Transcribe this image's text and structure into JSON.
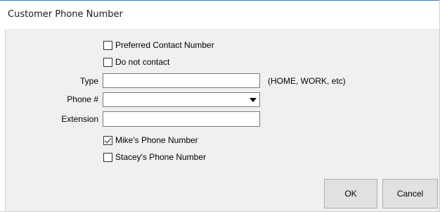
{
  "dialog": {
    "title": "Customer Phone Number"
  },
  "form": {
    "preferred_contact": {
      "label": "Preferred Contact Number",
      "checked": false
    },
    "do_not_contact": {
      "label": "Do not contact",
      "checked": false
    },
    "type": {
      "label": "Type",
      "value": "",
      "hint": "(HOME, WORK, etc)"
    },
    "phone": {
      "label": "Phone #",
      "value": ""
    },
    "extension": {
      "label": "Extension",
      "value": ""
    },
    "mikes_phone": {
      "label": "Mike's Phone Number",
      "checked": true
    },
    "staceys_phone": {
      "label": "Stacey's Phone Number",
      "checked": false
    }
  },
  "buttons": {
    "ok": "OK",
    "cancel": "Cancel"
  },
  "icons": {
    "dropdown": "chevron-down-icon",
    "check": "checkmark-icon"
  },
  "colors": {
    "accent": "#3c7fb1",
    "client_bg": "#f0f0f0",
    "button_bg": "#e1e1e1"
  }
}
